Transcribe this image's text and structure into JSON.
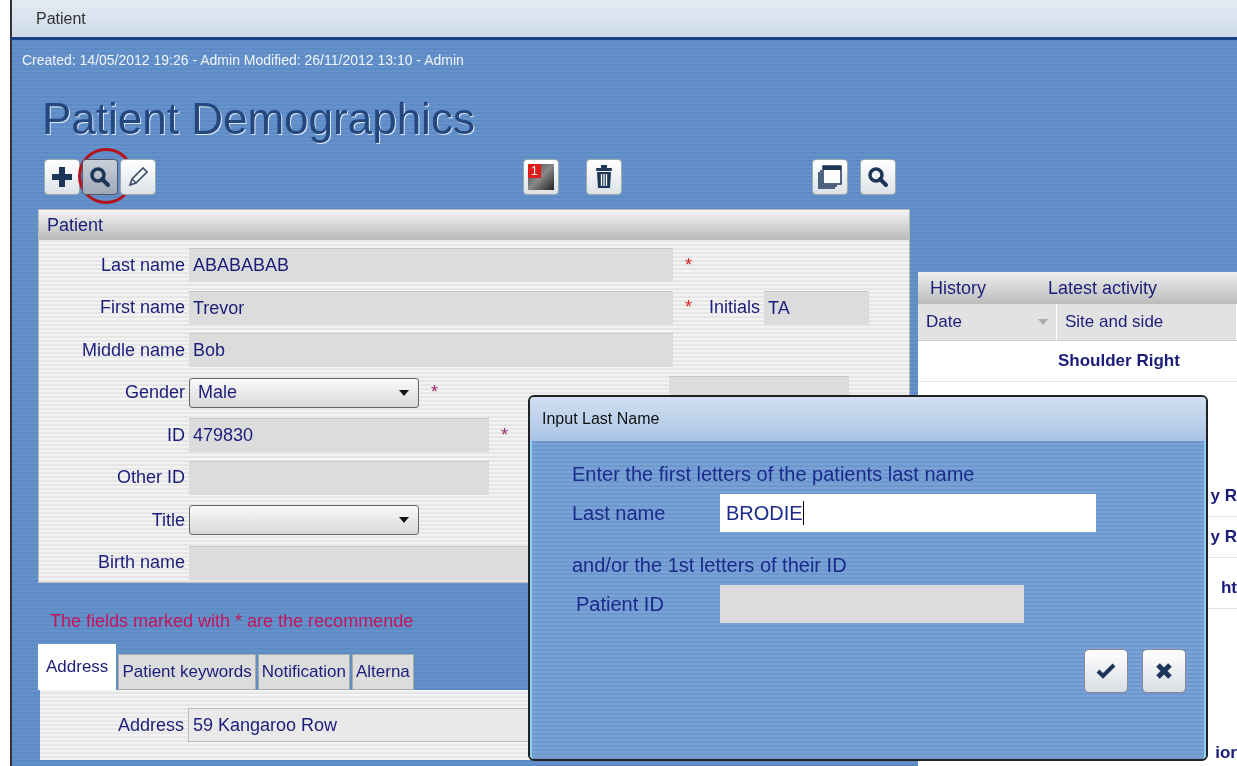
{
  "window": {
    "title": "Patient"
  },
  "meta": "Created: 14/05/2012 19:26 - Admin Modified: 26/11/2012 13:10 - Admin",
  "heading": "Patient Demographics",
  "toolbar": [
    {
      "kind": "add",
      "highlighted": false
    },
    {
      "kind": "search",
      "highlighted": true
    },
    {
      "kind": "edit",
      "highlighted": false
    },
    {
      "kind": "photos",
      "badge": "1",
      "highlighted": false
    },
    {
      "kind": "delete",
      "highlighted": false
    },
    {
      "kind": "window",
      "highlighted": false
    },
    {
      "kind": "search",
      "highlighted": false
    }
  ],
  "patient_panel": {
    "title": "Patient",
    "rows": [
      {
        "kind": "text",
        "label": "Last name",
        "value": "ABABABAB",
        "marker": "*"
      },
      {
        "kind": "text",
        "label": "First name",
        "value": "Trevor",
        "marker": "*",
        "initials": {
          "label": "Initials",
          "value": "TA"
        }
      },
      {
        "kind": "text",
        "label": "Middle name",
        "value": "Bob"
      },
      {
        "kind": "select",
        "label": "Gender",
        "value": "Male",
        "marker": "*"
      },
      {
        "kind": "text",
        "label": "ID",
        "value": "479830",
        "marker": "*"
      },
      {
        "kind": "text",
        "label": "Other ID",
        "value": ""
      },
      {
        "kind": "select",
        "label": "Title",
        "value": ""
      },
      {
        "kind": "text",
        "label": "Birth name",
        "value": ""
      }
    ]
  },
  "note": "The fields marked with * are the recommende",
  "tabs": [
    {
      "label": "Address",
      "selected": true
    },
    {
      "label": "Patient keywords",
      "selected": false
    },
    {
      "label": "Notification",
      "selected": false
    },
    {
      "label": "Alterna",
      "selected": false
    }
  ],
  "address": {
    "label": "Address",
    "value": "59 Kangaroo Row"
  },
  "history": {
    "title": "History",
    "subtitle": "Latest activity",
    "columns": [
      "Date",
      "Site and side"
    ],
    "rows": [
      {
        "kind": "full",
        "text": "Shoulder Right"
      },
      {
        "kind": "partial",
        "text": "y R"
      },
      {
        "kind": "partial",
        "text": "y R"
      },
      {
        "kind": "partial",
        "text": "ht"
      },
      {
        "kind": "partial",
        "text": "ior"
      }
    ]
  },
  "dialog": {
    "title": "Input Last Name",
    "prompt": "Enter the first letters of the patients last name",
    "last_name_label": "Last name",
    "last_name_value": "BRODIE",
    "prompt2": "and/or the 1st letters of their ID",
    "id_label": "Patient ID"
  }
}
